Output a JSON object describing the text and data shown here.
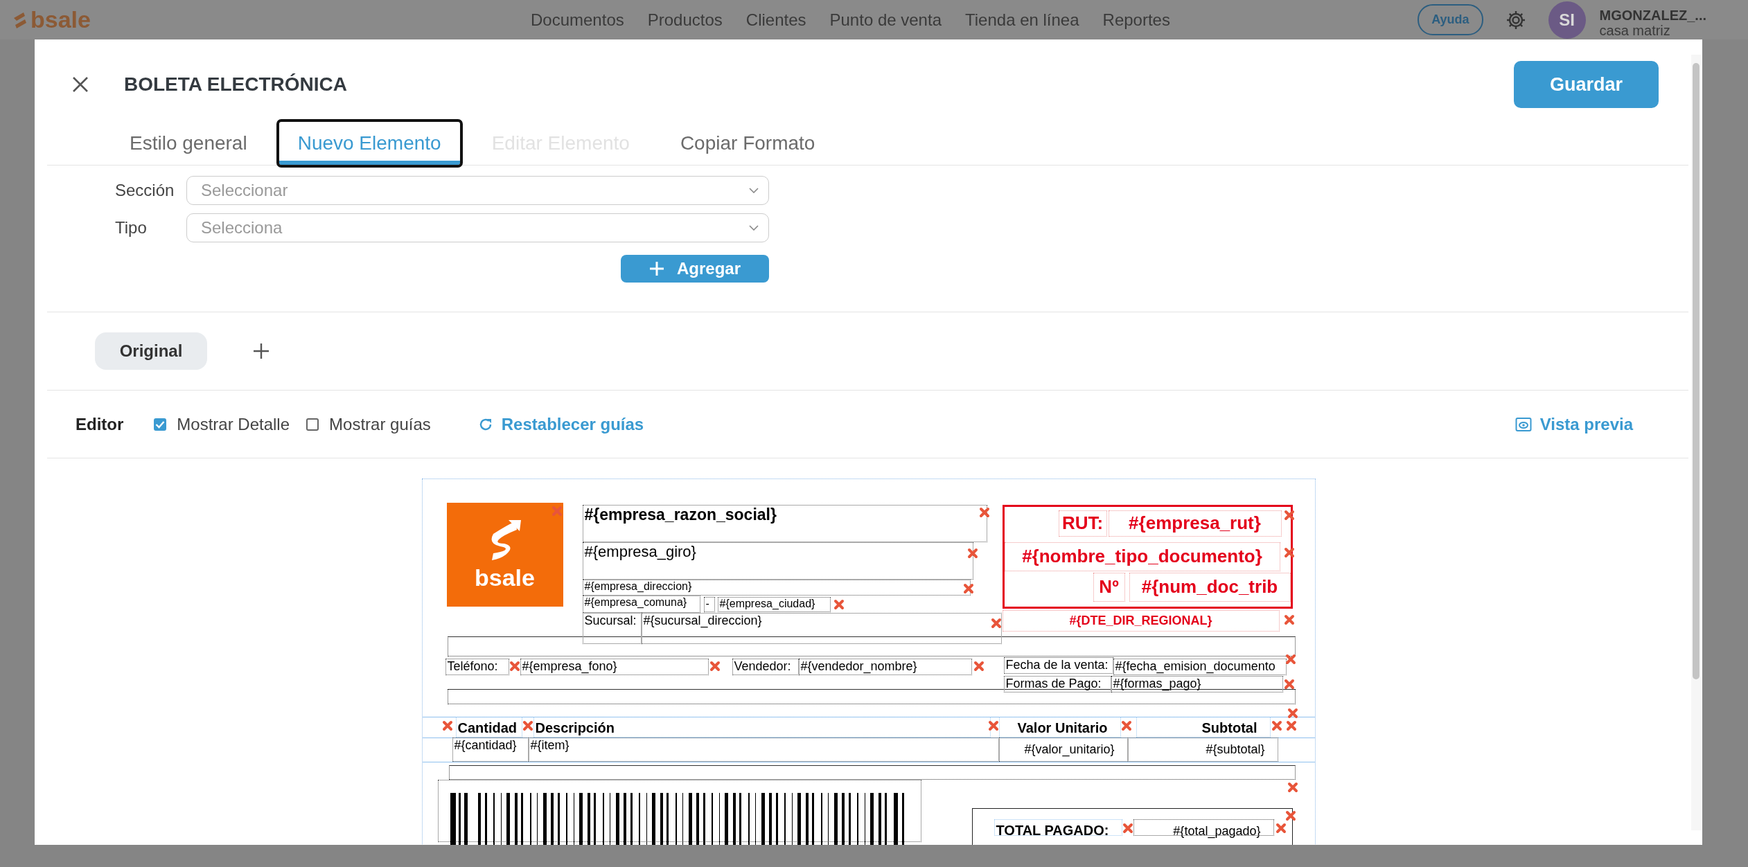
{
  "app_bar": {
    "logo": "bsale",
    "nav": [
      "Documentos",
      "Productos",
      "Clientes",
      "Punto de venta",
      "Tienda en línea",
      "Reportes"
    ],
    "help_button": "Ayuda",
    "avatar": "SI",
    "user_name": "MGONZALEZ_...",
    "branch": "casa matriz"
  },
  "dialog": {
    "title": "BOLETA ELECTRÓNICA",
    "save_button": "Guardar",
    "tabs": [
      {
        "label": "Estilo general",
        "selected": false,
        "disabled": false
      },
      {
        "label": "Nuevo Elemento",
        "selected": true,
        "disabled": false
      },
      {
        "label": "Editar Elemento",
        "selected": false,
        "disabled": true
      },
      {
        "label": "Copiar Formato",
        "selected": false,
        "disabled": false
      }
    ],
    "form": {
      "fields": [
        {
          "label": "Sección",
          "placeholder": "Seleccionar"
        },
        {
          "label": "Tipo",
          "placeholder": "Selecciona"
        }
      ],
      "add_button": "Agregar"
    },
    "versions": [
      {
        "label": "Original",
        "selected": true
      }
    ],
    "editor": {
      "label": "Editor",
      "options": [
        {
          "label": "Mostrar Detalle",
          "checked": true
        },
        {
          "label": "Mostrar guías",
          "checked": false
        }
      ],
      "reset_link": "Restablecer guías",
      "preview_link": "Vista previa"
    },
    "document": {
      "logo_text": "bsale",
      "fields": [
        {
          "text": "#{empresa_razon_social}",
          "kind": "bold"
        },
        {
          "text": "#{empresa_giro}",
          "kind": "large"
        },
        {
          "text": "#{empresa_direccion}",
          "kind": "small"
        },
        {
          "text": "#{empresa_comuna}",
          "kind": "small"
        },
        {
          "text": "-",
          "kind": "small"
        },
        {
          "text": "#{empresa_ciudad}",
          "kind": "small"
        },
        {
          "text": "Sucursal:",
          "kind": "text"
        },
        {
          "text": "#{sucursal_direccion}",
          "kind": "text"
        },
        {
          "text": "RUT:",
          "kind": "red"
        },
        {
          "text": "#{empresa_rut}",
          "kind": "red"
        },
        {
          "text": "#{nombre_tipo_documento}",
          "kind": "red"
        },
        {
          "text": "Nº",
          "kind": "red"
        },
        {
          "text": "#{num_doc_trib",
          "kind": "red"
        },
        {
          "text": "#{DTE_DIR_REGIONAL}",
          "kind": "red_small"
        },
        {
          "text": "Teléfono:",
          "kind": "text"
        },
        {
          "text": "#{empresa_fono}",
          "kind": "text"
        },
        {
          "text": "Vendedor:",
          "kind": "text"
        },
        {
          "text": "#{vendedor_nombre}",
          "kind": "text"
        },
        {
          "text": "Fecha de la venta:",
          "kind": "text"
        },
        {
          "text": "#{fecha_emision_documento",
          "kind": "text"
        },
        {
          "text": "Formas de Pago:",
          "kind": "text"
        },
        {
          "text": "#{formas_pago}",
          "kind": "text"
        },
        {
          "text": "Cantidad",
          "kind": "header"
        },
        {
          "text": "Descripción",
          "kind": "header"
        },
        {
          "text": "Valor Unitario",
          "kind": "header_right"
        },
        {
          "text": "Subtotal",
          "kind": "header_right"
        },
        {
          "text": "#{cantidad}",
          "kind": "text"
        },
        {
          "text": "#{item}",
          "kind": "text"
        },
        {
          "text": "#{valor_unitario}",
          "kind": "right"
        },
        {
          "text": "#{subtotal}",
          "kind": "right"
        },
        {
          "text": "TOTAL PAGADO:",
          "kind": "header"
        },
        {
          "text": "#{total_pagado}",
          "kind": "right"
        }
      ]
    }
  }
}
